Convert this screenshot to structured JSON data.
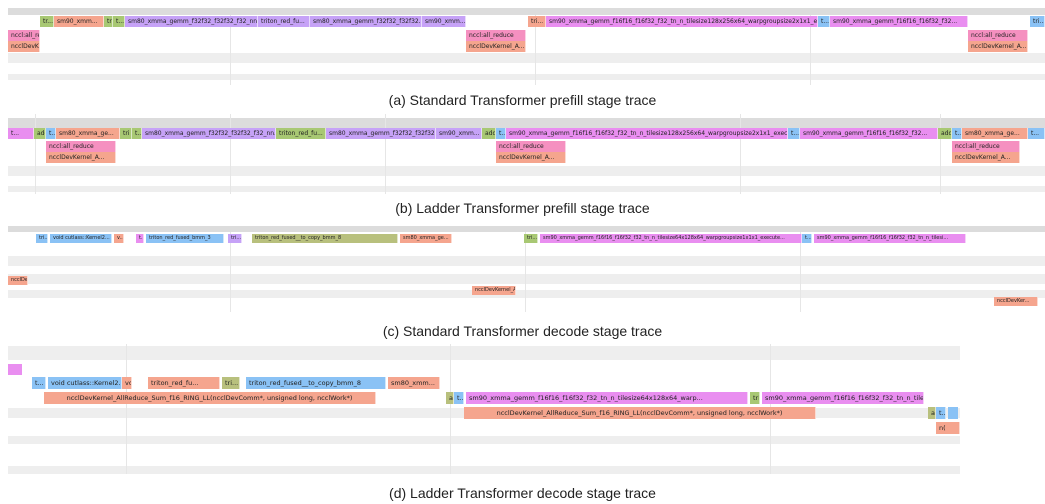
{
  "panels": [
    {
      "caption": "(a) Standard Transformer prefill stage trace",
      "kernels": [
        [
          "tr...",
          "#a8c873"
        ],
        [
          "sm90_xmm...",
          "#f5a58e"
        ],
        [
          "tri",
          "#a8c873"
        ],
        [
          "t...",
          "#a8c873"
        ],
        [
          "sm80_xmma_gemm_f32f32_f32f32_f32_nn...",
          "#c6a2f7"
        ],
        [
          "triton_red_fu...",
          "#c6a2f7"
        ],
        [
          "sm80_xmma_gemm_f32f32_f32f32...",
          "#c6a2f7"
        ],
        [
          "sm90_xmm...",
          "#c6a2f7"
        ],
        [
          "tri...",
          "#f5a58e"
        ],
        [
          "sm90_xmma_gemm_f16f16_f16f32_f32_tn_n_tilesize128x256x64_warpgroupsize2x1x1_execute...",
          "#e98ef0"
        ],
        [
          "t...",
          "#8ac2f5"
        ],
        [
          "sm90_xmma_gemm_f16f16_f16f32_f32...",
          "#e98ef0"
        ],
        [
          "tri...",
          "#8ac2f5"
        ]
      ],
      "comm": [
        "nccl:all_reduce",
        "ncclDevKernel_A...",
        "nccl:all_reduce",
        "ncclDevKernel_A...",
        "nccl:all_reduce",
        "ncclDevKernel_A..."
      ]
    },
    {
      "caption": "(b) Ladder Transformer prefill stage trace",
      "kernels": [
        [
          "t...",
          "#e98ef0"
        ],
        [
          "add",
          "#a8c873"
        ],
        [
          "t...",
          "#8ac2f5"
        ],
        [
          "sm80_xmma_ge...",
          "#f5a58e"
        ],
        [
          "tri",
          "#a8c873"
        ],
        [
          "t...",
          "#a8c873"
        ],
        [
          "sm80_xmma_gemm_f32f32_f32f32_f32_nn...",
          "#c6a2f7"
        ],
        [
          "triton_red_fu...",
          "#a8c873"
        ],
        [
          "sm80_xmma_gemm_f32f32_f32f32...",
          "#c6a2f7"
        ],
        [
          "sm90_xmm...",
          "#c6a2f7"
        ],
        [
          "add",
          "#a8c873"
        ],
        [
          "t...",
          "#8ac2f5"
        ],
        [
          "sm90_xmma_gemm_f16f16_f16f32_f32_tn_n_tilesize128x256x64_warpgroupsize2x1x1_execute...",
          "#e98ef0"
        ],
        [
          "t...",
          "#8ac2f5"
        ],
        [
          "sm90_xmma_gemm_f16f16_f16f32_f32...",
          "#e98ef0"
        ],
        [
          "add",
          "#a8c873"
        ],
        [
          "t...",
          "#8ac2f5"
        ],
        [
          "sm80_xmma_ge...",
          "#f5a58e"
        ],
        [
          "t...",
          "#8ac2f5"
        ]
      ],
      "comm": [
        "nccl:all_reduce",
        "ncclDevKernel_A...",
        "nccl:all_reduce",
        "ncclDevKernel_A...",
        "nccl:all_reduce",
        "ncclDevKernel_A..."
      ]
    },
    {
      "caption": "(c) Standard Transformer decode stage trace",
      "kernels": [
        [
          "tri...",
          "#8ac2f5"
        ],
        [
          "void cutlass::Kernel2...",
          "#8ac2f5"
        ],
        [
          "v...",
          "#f5a58e"
        ],
        [
          "t...",
          "#e98ef0"
        ],
        [
          "triton_red_fused_bmm_3",
          "#8ac2f5"
        ],
        [
          "tri...",
          "#c6a2f7"
        ],
        [
          "triton_red_fused__to_copy_bmm_8",
          "#b8c07d"
        ],
        [
          "sm80_xmma_ge...",
          "#f5a58e"
        ],
        [
          "tri...",
          "#a8c873"
        ],
        [
          "sm90_xmma_gemm_f16f16_f16f32_f32_tn_n_tilesize64x128x64_warpgroupsize1x1x1_execute...",
          "#e98ef0"
        ],
        [
          "t...",
          "#8ac2f5"
        ],
        [
          "sm90_xmma_gemm_f16f16_f16f32_f32_tn_n_tilesi...",
          "#e98ef0"
        ]
      ],
      "comm": [
        "ncclDevKer...",
        "ncclDevKernel_A...",
        "ncclDevKer..."
      ]
    },
    {
      "caption": "(d) Ladder Transformer decode stage trace",
      "kernels": [
        [
          "t...",
          "#8ac2f5"
        ],
        [
          "void cutlass::Kernel2...",
          "#8ac2f5"
        ],
        [
          "vo",
          "#f5a58e"
        ],
        [
          "triton_red_fu...",
          "#f5a58e"
        ],
        [
          "tri...",
          "#b8c07d"
        ],
        [
          "triton_red_fused__to_copy_bmm_8",
          "#8ac2f5"
        ],
        [
          "sm80_xmm...",
          "#f5a58e"
        ],
        [
          "a",
          "#b8c07d"
        ],
        [
          "t...",
          "#8ac2f5"
        ],
        [
          "sm90_xmma_gemm_f16f16_f16f32_f32_tn_n_tilesize64x128x64_warp...",
          "#e98ef0"
        ],
        [
          "tri",
          "#a8c873"
        ],
        [
          "sm90_xmma_gemm_f16f16_f16f32_f32_tn_n_tilesi...",
          "#e98ef0"
        ],
        [
          "a",
          "#b8c07d"
        ],
        [
          "t...",
          "#8ac2f5"
        ]
      ],
      "comm": [
        "ncclDevKernel_AllReduce_Sum_f16_RING_LL(ncclDevComm*, unsigned long, ncclWork*)",
        "ncclDevKernel_AllReduce_Sum_f16_RING_LL(ncclDevComm*, unsigned long, ncclWork*)",
        "n("
      ]
    }
  ],
  "colors": {
    "gemm": "#e98ef0",
    "fp32gemm": "#c6a2f7",
    "triton": "#a8c873",
    "elementwise": "#8ac2f5",
    "nccl": "#f5a58e",
    "band": "#eeeeee"
  }
}
